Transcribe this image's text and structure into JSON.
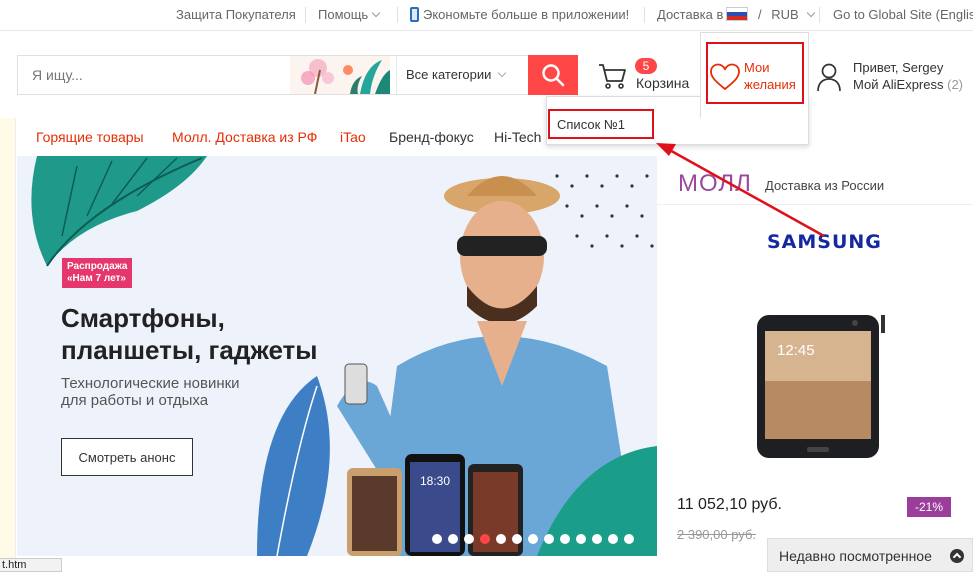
{
  "topbar": {
    "protection": "Защита Покупателя",
    "help": "Помощь",
    "app_promo": "Экономьте больше в приложении!",
    "ship_to": "Доставка в",
    "currency_sep": "/",
    "currency": "RUB",
    "global_site": "Go to Global Site (English"
  },
  "search": {
    "placeholder": "Я ищу...",
    "category": "Все категории"
  },
  "cart": {
    "count": "5",
    "label": "Корзина"
  },
  "wishlist": {
    "label": "Мои желания",
    "list_item": "Список №1"
  },
  "account": {
    "greeting": "Привет, Sergey",
    "my_label": "Мой AliExpress",
    "my_count": "(2)"
  },
  "category_nav": [
    {
      "label": "Горящие товары",
      "color": "#e62e04"
    },
    {
      "label": "Молл. Доставка из РФ",
      "color": "#e62e04"
    },
    {
      "label": "iTao",
      "color": "#e62e04"
    },
    {
      "label": "Бренд-фокус",
      "color": "#333333"
    },
    {
      "label": "Hi-Tech",
      "color": "#333333"
    }
  ],
  "banner": {
    "tag": "Распродажа «Нам 7 лет»",
    "title": "Смартфоны,\nпланшеты, гаджеты",
    "subtitle": "Технологические новинки\nдля работы и отдыха",
    "button": "Смотреть анонс",
    "phone_time": "18:30",
    "slides": 13,
    "active_slide": 4
  },
  "mall": {
    "title": "МОЛЛ",
    "subtitle": "Доставка из России",
    "brand": "SAMSUNG",
    "phone_time": "12:45",
    "price": "11 052,10 руб.",
    "old_price": "2 390,00 руб.",
    "discount": "-21%"
  },
  "recent": {
    "label": "Недавно посмотренное"
  },
  "status_bar": {
    "url": "t.htm"
  },
  "colors": {
    "accent": "#ff4747",
    "annotation": "#e0101a",
    "mall": "#9a4a9a"
  }
}
